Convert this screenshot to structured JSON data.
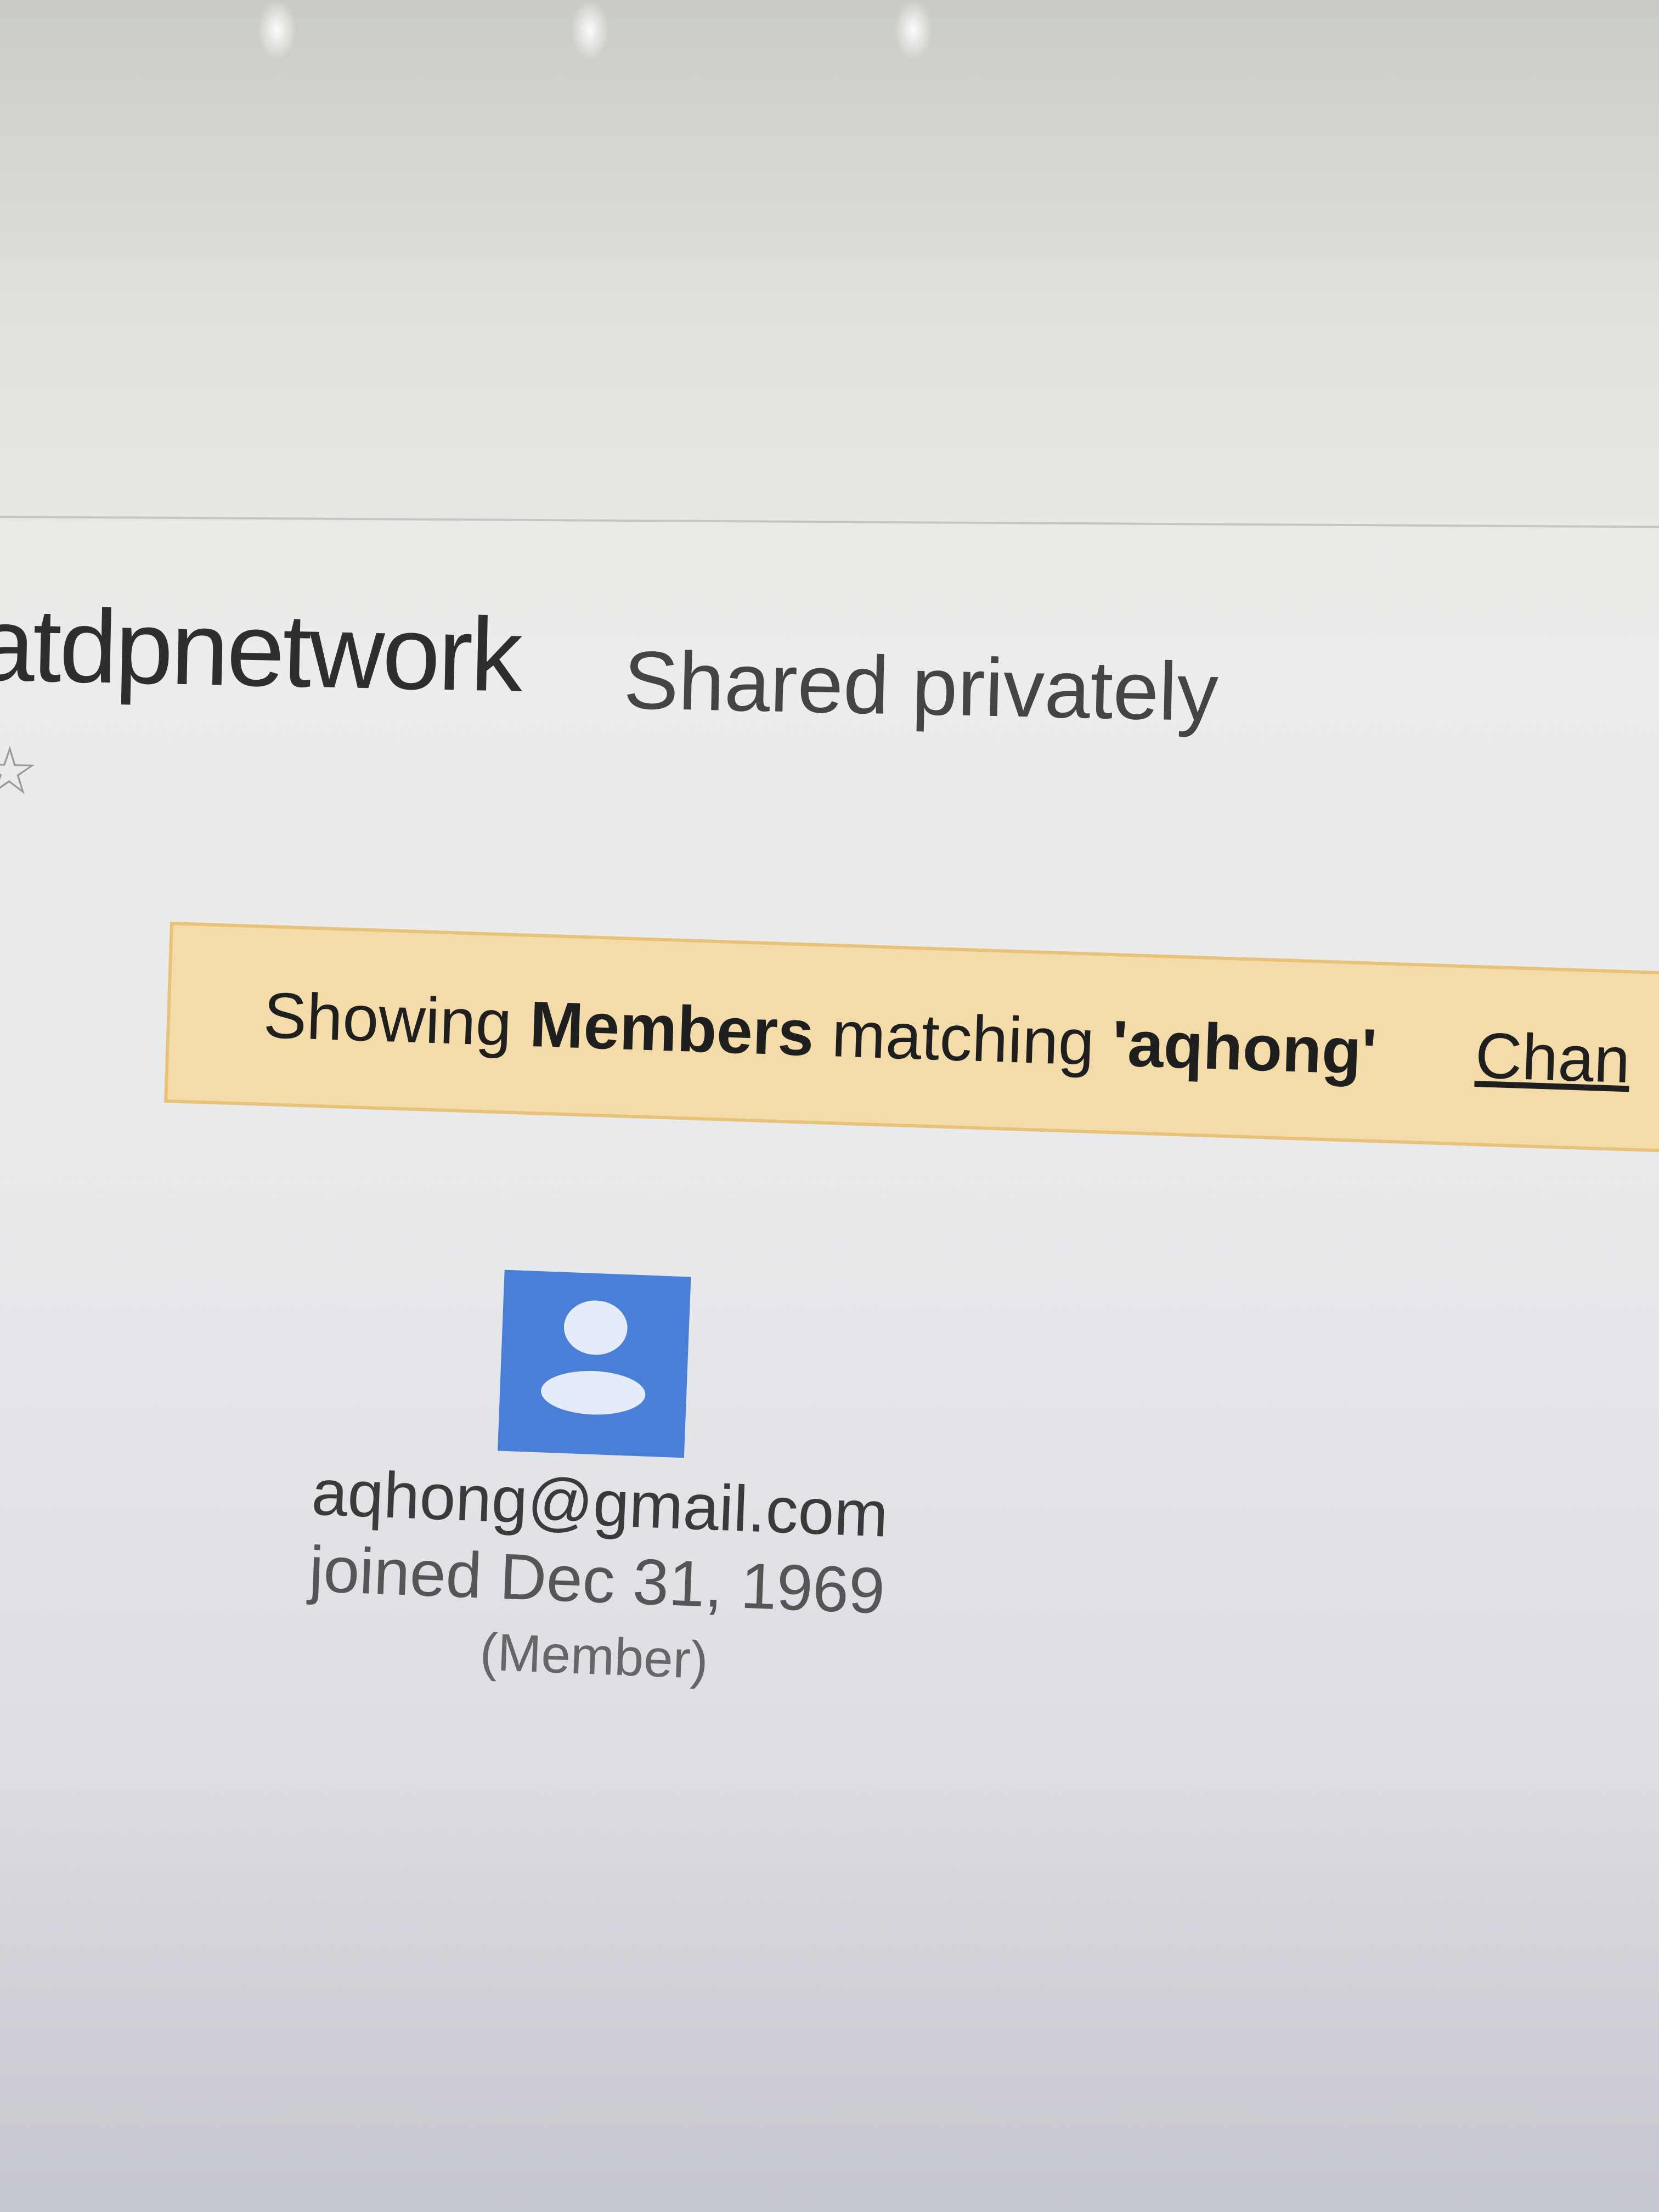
{
  "header": {
    "group_name": "atdpnetwork",
    "shared_status": "Shared privately"
  },
  "notice": {
    "prefix": "Showing ",
    "entity": "Members",
    "middle": " matching ",
    "query": "'aqhong'",
    "change_link": "Chan"
  },
  "member": {
    "email": "aqhong@gmail.com",
    "joined": "joined Dec 31, 1969",
    "role": "(Member)"
  },
  "colors": {
    "notice_background": "#f4dcaa",
    "notice_border": "#e9c27a",
    "avatar_background": "#4a7fd8"
  },
  "icons": {
    "favorite": "star-icon",
    "avatar": "person-icon"
  }
}
